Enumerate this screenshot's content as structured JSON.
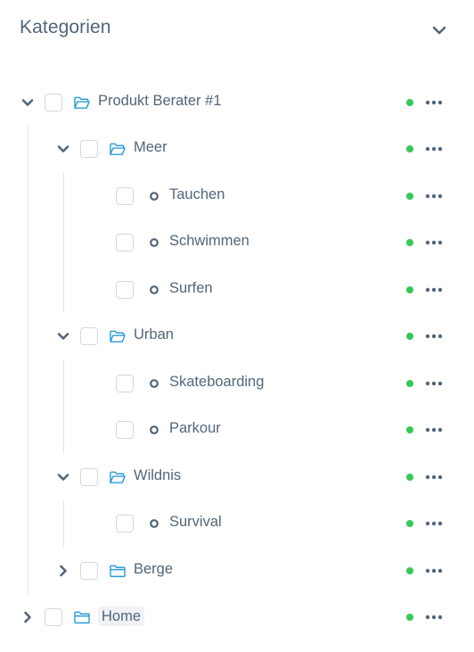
{
  "panel": {
    "title": "Kategorien",
    "toggle_icon": "chevron-down-icon"
  },
  "colors": {
    "text": "#52667a",
    "folder_icon": "#2b9bd8",
    "status_active": "#37c855",
    "checkbox_border": "#d1d9e0",
    "guide_line": "#dfe4ea"
  },
  "tree": [
    {
      "label": "Produkt Berater #1",
      "type": "folder",
      "expanded": true,
      "status": "active"
    },
    {
      "label": "Meer",
      "type": "folder",
      "expanded": true,
      "status": "active"
    },
    {
      "label": "Tauchen",
      "type": "leaf",
      "status": "active"
    },
    {
      "label": "Schwimmen",
      "type": "leaf",
      "status": "active"
    },
    {
      "label": "Surfen",
      "type": "leaf",
      "status": "active"
    },
    {
      "label": "Urban",
      "type": "folder",
      "expanded": true,
      "status": "active"
    },
    {
      "label": "Skateboarding",
      "type": "leaf",
      "status": "active"
    },
    {
      "label": "Parkour",
      "type": "leaf",
      "status": "active"
    },
    {
      "label": "Wildnis",
      "type": "folder",
      "expanded": true,
      "status": "active"
    },
    {
      "label": "Survival",
      "type": "leaf",
      "status": "active"
    },
    {
      "label": "Berge",
      "type": "folder",
      "expanded": false,
      "status": "active"
    },
    {
      "label": "Home",
      "type": "folder",
      "expanded": false,
      "status": "active"
    }
  ]
}
